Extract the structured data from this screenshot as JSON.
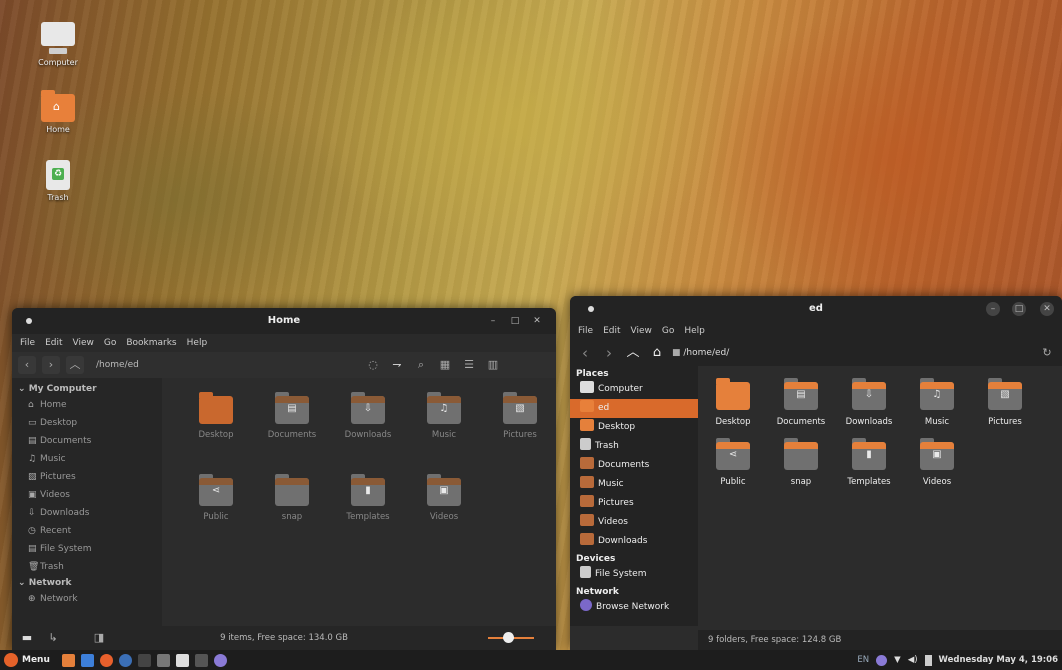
{
  "desktop": {
    "icons": [
      {
        "label": "Computer"
      },
      {
        "label": "Home"
      },
      {
        "label": "Trash"
      }
    ]
  },
  "left_window": {
    "title": "Home",
    "menu": [
      "File",
      "Edit",
      "View",
      "Go",
      "Bookmarks",
      "Help"
    ],
    "path": "/home/ed",
    "sidebar": {
      "sections": [
        {
          "heading": "My Computer",
          "items": [
            "Home",
            "Desktop",
            "Documents",
            "Music",
            "Pictures",
            "Videos",
            "Downloads",
            "Recent",
            "File System",
            "Trash"
          ]
        },
        {
          "heading": "Network",
          "items": [
            "Network"
          ]
        }
      ]
    },
    "files": [
      "Desktop",
      "Documents",
      "Downloads",
      "Music",
      "Pictures",
      "Public",
      "snap",
      "Templates",
      "Videos"
    ],
    "status": "9 items, Free space: 134.0 GB"
  },
  "right_window": {
    "title": "ed",
    "menu": [
      "File",
      "Edit",
      "View",
      "Go",
      "Help"
    ],
    "path": "/home/ed/",
    "sidebar": {
      "places_heading": "Places",
      "places": [
        "Computer",
        "ed",
        "Desktop",
        "Trash",
        "Documents",
        "Music",
        "Pictures",
        "Videos",
        "Downloads"
      ],
      "devices_heading": "Devices",
      "devices": [
        "File System"
      ],
      "network_heading": "Network",
      "network": [
        "Browse Network"
      ]
    },
    "files": [
      "Desktop",
      "Documents",
      "Downloads",
      "Music",
      "Pictures",
      "Public",
      "snap",
      "Templates",
      "Videos"
    ],
    "status": "9 folders, Free space: 124.8 GB"
  },
  "taskbar": {
    "menu_label": "Menu",
    "lang": "EN",
    "datetime": "Wednesday May  4, 19:06"
  },
  "colors": {
    "accent": "#e5803b",
    "selected": "#d96a2b"
  }
}
